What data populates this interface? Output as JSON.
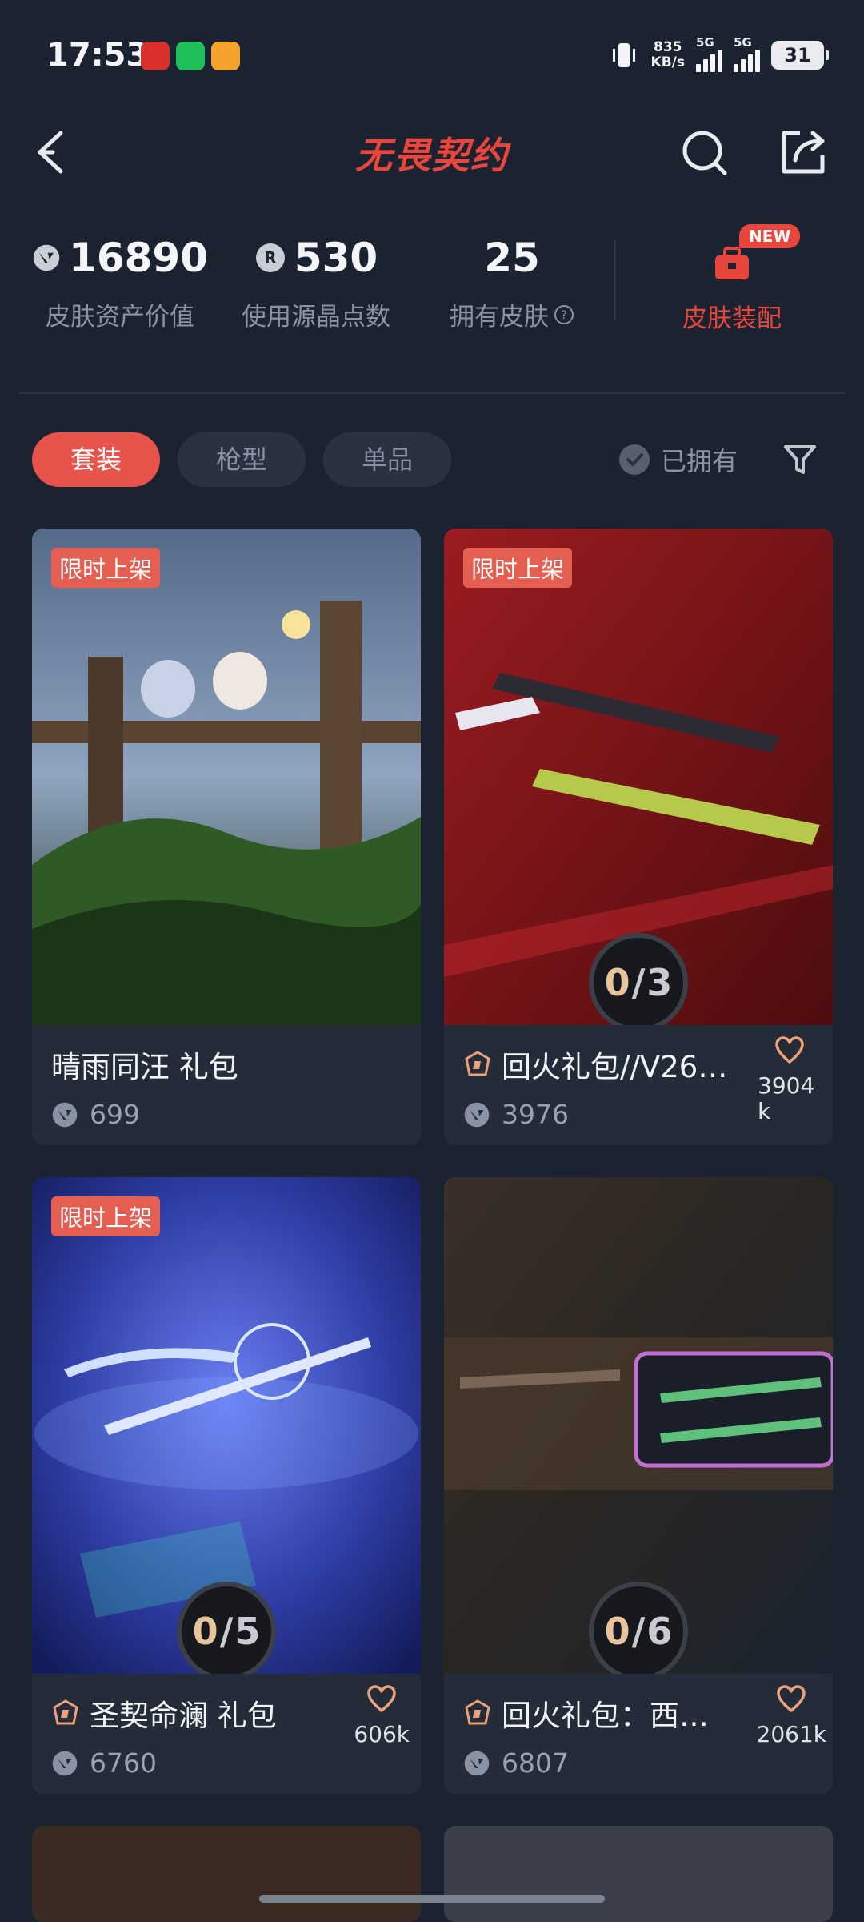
{
  "status_bar": {
    "time": "17:53",
    "speed_value": "835",
    "speed_unit": "KB/s",
    "signal1_label": "5G",
    "signal2_label": "5G",
    "battery": "31"
  },
  "header": {
    "brand": "无畏契约",
    "back_icon": "chevron-left-icon",
    "search_icon": "search-icon",
    "share_icon": "share-icon"
  },
  "stats": {
    "asset_value": "16890",
    "asset_label": "皮肤资产价值",
    "points_value": "530",
    "points_label": "使用源晶点数",
    "owned_value": "25",
    "owned_label": "拥有皮肤",
    "equip_badge": "NEW",
    "equip_label": "皮肤装配"
  },
  "filters": {
    "tabs": [
      "套装",
      "枪型",
      "单品"
    ],
    "active_tab": "套装",
    "owned_label": "已拥有"
  },
  "cards": [
    {
      "tag": "限时上架",
      "title": "晴雨同汪 礼包",
      "price": "699",
      "favorites": "",
      "progress": "",
      "colors": [
        "#3c5478",
        "#6c8aa8"
      ]
    },
    {
      "tag": "限时上架",
      "title": "回火礼包//V26…",
      "price": "3976",
      "favorites": "3904k",
      "progress_owned": "0",
      "progress_total": "3",
      "colors": [
        "#6e1416",
        "#a22327"
      ]
    },
    {
      "tag": "限时上架",
      "title": "圣契命澜 礼包",
      "price": "6760",
      "favorites": "606k",
      "progress_owned": "0",
      "progress_total": "5",
      "colors": [
        "#2e3a9a",
        "#5a6ee0"
      ]
    },
    {
      "tag": "",
      "title": "回火礼包：西…",
      "price": "6807",
      "favorites": "2061k",
      "progress_owned": "0",
      "progress_total": "6",
      "colors": [
        "#2a2420",
        "#3a3631"
      ]
    }
  ]
}
